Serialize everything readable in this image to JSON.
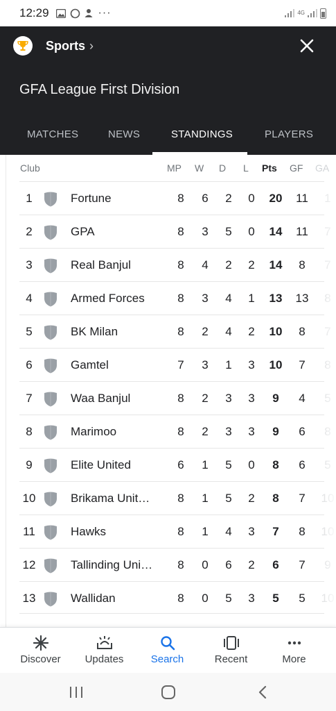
{
  "status": {
    "time": "12:29",
    "network": "4G"
  },
  "header": {
    "breadcrumb": "Sports",
    "league_title": "GFA League First Division",
    "tabs": [
      {
        "label": "MATCHES"
      },
      {
        "label": "NEWS"
      },
      {
        "label": "STANDINGS"
      },
      {
        "label": "PLAYERS"
      }
    ],
    "active_tab": "STANDINGS"
  },
  "table": {
    "headers": {
      "club": "Club",
      "mp": "MP",
      "w": "W",
      "d": "D",
      "l": "L",
      "pts": "Pts",
      "gf": "GF",
      "ga": "GA"
    },
    "rows": [
      {
        "pos": "1",
        "club": "Fortune",
        "mp": "8",
        "w": "6",
        "d": "2",
        "l": "0",
        "pts": "20",
        "gf": "11",
        "ga": "1"
      },
      {
        "pos": "2",
        "club": "GPA",
        "mp": "8",
        "w": "3",
        "d": "5",
        "l": "0",
        "pts": "14",
        "gf": "11",
        "ga": "7"
      },
      {
        "pos": "3",
        "club": "Real Banjul",
        "mp": "8",
        "w": "4",
        "d": "2",
        "l": "2",
        "pts": "14",
        "gf": "8",
        "ga": "7"
      },
      {
        "pos": "4",
        "club": "Armed Forces",
        "mp": "8",
        "w": "3",
        "d": "4",
        "l": "1",
        "pts": "13",
        "gf": "13",
        "ga": "8"
      },
      {
        "pos": "5",
        "club": "BK Milan",
        "mp": "8",
        "w": "2",
        "d": "4",
        "l": "2",
        "pts": "10",
        "gf": "8",
        "ga": "7"
      },
      {
        "pos": "6",
        "club": "Gamtel",
        "mp": "7",
        "w": "3",
        "d": "1",
        "l": "3",
        "pts": "10",
        "gf": "7",
        "ga": "8"
      },
      {
        "pos": "7",
        "club": "Waa Banjul",
        "mp": "8",
        "w": "2",
        "d": "3",
        "l": "3",
        "pts": "9",
        "gf": "4",
        "ga": "5"
      },
      {
        "pos": "8",
        "club": "Marimoo",
        "mp": "8",
        "w": "2",
        "d": "3",
        "l": "3",
        "pts": "9",
        "gf": "6",
        "ga": "8"
      },
      {
        "pos": "9",
        "club": "Elite United",
        "mp": "6",
        "w": "1",
        "d": "5",
        "l": "0",
        "pts": "8",
        "gf": "6",
        "ga": "5"
      },
      {
        "pos": "10",
        "club": "Brikama Unit…",
        "mp": "8",
        "w": "1",
        "d": "5",
        "l": "2",
        "pts": "8",
        "gf": "7",
        "ga": "10"
      },
      {
        "pos": "11",
        "club": "Hawks",
        "mp": "8",
        "w": "1",
        "d": "4",
        "l": "3",
        "pts": "7",
        "gf": "8",
        "ga": "10"
      },
      {
        "pos": "12",
        "club": "Tallinding Uni…",
        "mp": "8",
        "w": "0",
        "d": "6",
        "l": "2",
        "pts": "6",
        "gf": "7",
        "ga": "9"
      },
      {
        "pos": "13",
        "club": "Wallidan",
        "mp": "8",
        "w": "0",
        "d": "5",
        "l": "3",
        "pts": "5",
        "gf": "5",
        "ga": "10"
      }
    ]
  },
  "bottom_nav": [
    {
      "label": "Discover",
      "icon": "asterisk-icon"
    },
    {
      "label": "Updates",
      "icon": "updates-icon"
    },
    {
      "label": "Search",
      "icon": "search-icon"
    },
    {
      "label": "Recent",
      "icon": "recent-tabs-icon"
    },
    {
      "label": "More",
      "icon": "more-dots-icon"
    }
  ],
  "active_nav": "Search",
  "colors": {
    "header_bg": "#202124",
    "accent": "#1a73e8",
    "shield": "#9aa0a6"
  }
}
